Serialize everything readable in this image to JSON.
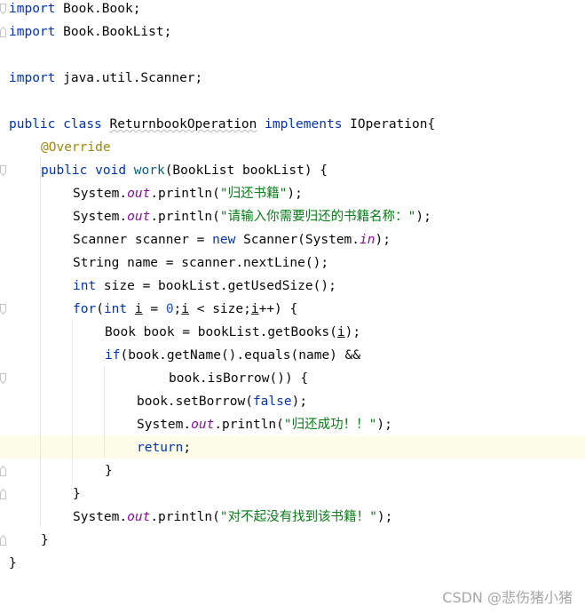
{
  "code": {
    "l1": {
      "kw": "import",
      "rest": " Book.Book;"
    },
    "l2": {
      "kw": "import",
      "rest": " Book.BookList;"
    },
    "l4": {
      "kw": "import",
      "rest": " java.util.Scanner;"
    },
    "l6": {
      "kw1": "public",
      "sp1": " ",
      "kw2": "class",
      "sp2": " ",
      "cls": "ReturnbookOperation",
      "sp3": " ",
      "kw3": "implements",
      "rest": " IOperation{"
    },
    "l7": {
      "ann": "@Override"
    },
    "l8": {
      "kw1": "public",
      "sp1": " ",
      "kw2": "void",
      "sp2": " ",
      "fn": "work",
      "rest": "(BookList bookList) {"
    },
    "l9": {
      "a": "System.",
      "fld": "out",
      "b": ".println(",
      "str": "\"归还书籍\"",
      "c": ");"
    },
    "l10": {
      "a": "System.",
      "fld": "out",
      "b": ".println(",
      "str": "\"请输入你需要归还的书籍名称：\"",
      "c": ");"
    },
    "l11": {
      "a": "Scanner scanner = ",
      "kw": "new",
      "b": " Scanner(System.",
      "fld": "in",
      "c": ");"
    },
    "l12": {
      "a": "String name = scanner.nextLine();"
    },
    "l13": {
      "kw": "int",
      "a": " size = bookList.getUsedSize();"
    },
    "l14": {
      "kw1": "for",
      "a": "(",
      "kw2": "int",
      "b": " ",
      "v1": "i",
      "c": " = ",
      "num": "0",
      "d": ";",
      "v2": "i",
      "e": " < size;",
      "v3": "i",
      "f": "++) {"
    },
    "l15": {
      "a": "Book book = bookList.getBooks(",
      "v": "i",
      "b": ");"
    },
    "l16": {
      "kw": "if",
      "a": "(book.getName().equals(name) &&"
    },
    "l17": {
      "a": "book.isBorrow()) {"
    },
    "l18": {
      "a": "book.setBorrow(",
      "kw": "false",
      "b": ");"
    },
    "l19": {
      "a": "System.",
      "fld": "out",
      "b": ".println(",
      "str": "\"归还成功！！\"",
      "c": ");"
    },
    "l20": {
      "kw": "return",
      "a": ";"
    },
    "l21": {
      "a": "}"
    },
    "l22": {
      "a": "}"
    },
    "l23": {
      "a": "System.",
      "fld": "out",
      "b": ".println(",
      "str": "\"对不起没有找到该书籍！\"",
      "c": ");"
    },
    "l24": {
      "a": "}"
    },
    "l25": {
      "a": "}"
    }
  },
  "watermark": "CSDN @悲伤猪小猪",
  "colors": {
    "keyword": "#0033b3",
    "annotation": "#9e880d",
    "method_decl": "#00627a",
    "string": "#067d17",
    "static_field": "#871094",
    "number": "#1750eb",
    "text": "#080808",
    "current_line": "#fdfce9"
  }
}
